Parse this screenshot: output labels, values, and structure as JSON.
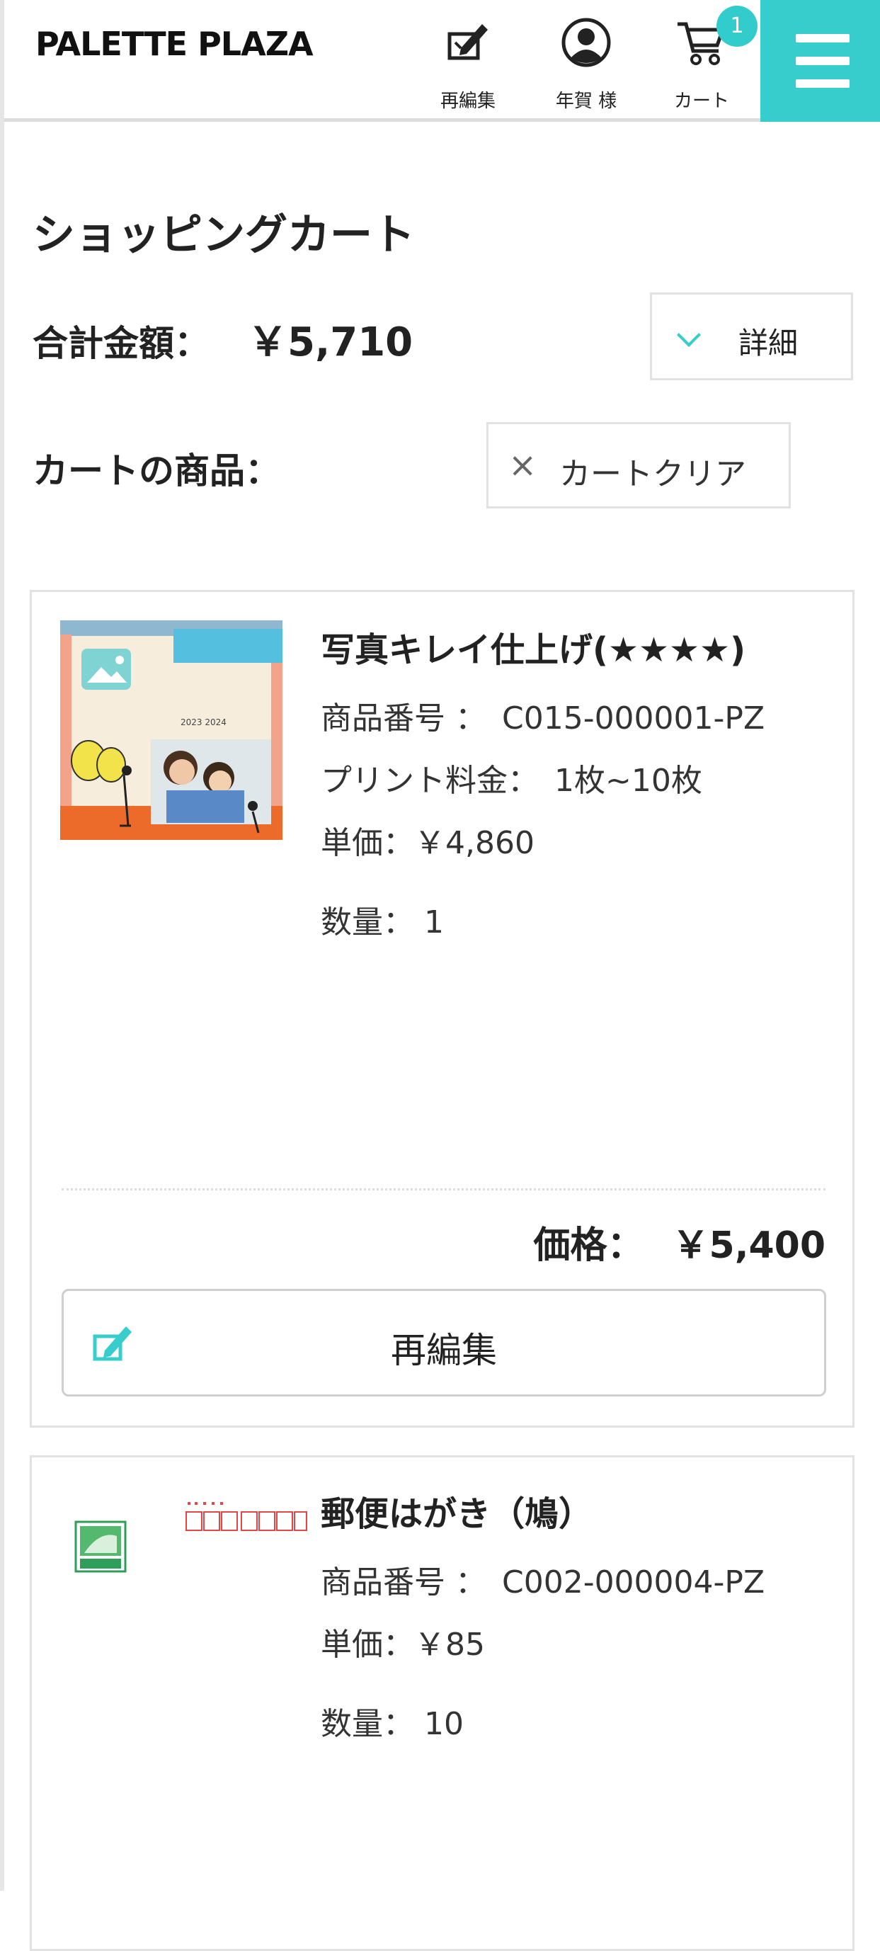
{
  "header": {
    "logo": "PALETTE PLAZA",
    "nav": {
      "reedit": "再編集",
      "user": "年賀 様",
      "cart": "カート"
    },
    "cart_count": "1",
    "accent_color": "#36cdcc",
    "menu_icon": "hamburger-icon"
  },
  "page": {
    "title": "ショッピングカート",
    "total_label": "合計金額：",
    "total_value": "￥5,710",
    "detail_button": "詳細",
    "items_label": "カートの商品：",
    "clear_button": "カートクリア"
  },
  "items": [
    {
      "title": "写真キレイ仕上げ(★★★★)",
      "product_no": "商品番号 ：　C015-000001-PZ",
      "print_fee": "プリント料金：　1枚~10枚",
      "unit_price": "単価：￥4,860",
      "quantity": "数量：  1",
      "price_label": "価格：",
      "price_value": "￥5,400",
      "reedit_button": "再編集"
    },
    {
      "title": "郵便はがき（鳩）",
      "product_no": "商品番号 ：　C002-000004-PZ",
      "unit_price": "単価：￥85",
      "quantity": "数量：  10"
    }
  ]
}
